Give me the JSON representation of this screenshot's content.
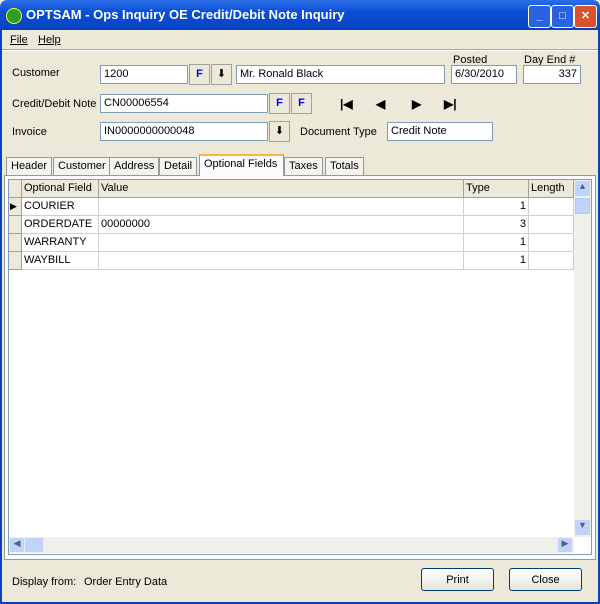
{
  "window": {
    "title": "OPTSAM - Ops Inquiry OE Credit/Debit Note Inquiry",
    "minimize": "_",
    "maximize": "□",
    "close": "✕"
  },
  "menu": [
    {
      "label": "File"
    },
    {
      "label": "Help"
    }
  ],
  "form": {
    "customer_label": "Customer",
    "customer_value": "1200",
    "customer_name": "Mr. Ronald Black",
    "posted_label": "Posted",
    "posted_value": "6/30/2010",
    "day_end_label": "Day End #",
    "day_end_value": "337",
    "note_label": "Credit/Debit Note",
    "note_value": "CN00006554",
    "invoice_label": "Invoice",
    "invoice_value": "IN0000000000048",
    "doctype_label": "Document Type",
    "doctype_value": "Credit Note",
    "finder_glyph": "F",
    "drill_glyph": "⬇",
    "nav": {
      "first": "|◀",
      "prev": "◀",
      "next": "▶",
      "last": "▶|"
    }
  },
  "tabs": [
    {
      "label": "Header"
    },
    {
      "label": "Customer"
    },
    {
      "label": "Address"
    },
    {
      "label": "Detail"
    },
    {
      "label": "Optional Fields",
      "active": true
    },
    {
      "label": "Taxes"
    },
    {
      "label": "Totals"
    }
  ],
  "grid": {
    "columns": [
      "Optional Field",
      "Value",
      "Type",
      "Length"
    ],
    "rows": [
      {
        "field": "COURIER",
        "value": "",
        "type": "1",
        "length": ""
      },
      {
        "field": "ORDERDATE",
        "value": "00000000",
        "type": "3",
        "length": ""
      },
      {
        "field": "WARRANTY",
        "value": "",
        "type": "1",
        "length": ""
      },
      {
        "field": "WAYBILL",
        "value": "",
        "type": "1",
        "length": ""
      }
    ]
  },
  "footer": {
    "display_from_label": "Display from:",
    "display_from_value": "Order Entry Data",
    "print": "Print",
    "close": "Close"
  }
}
